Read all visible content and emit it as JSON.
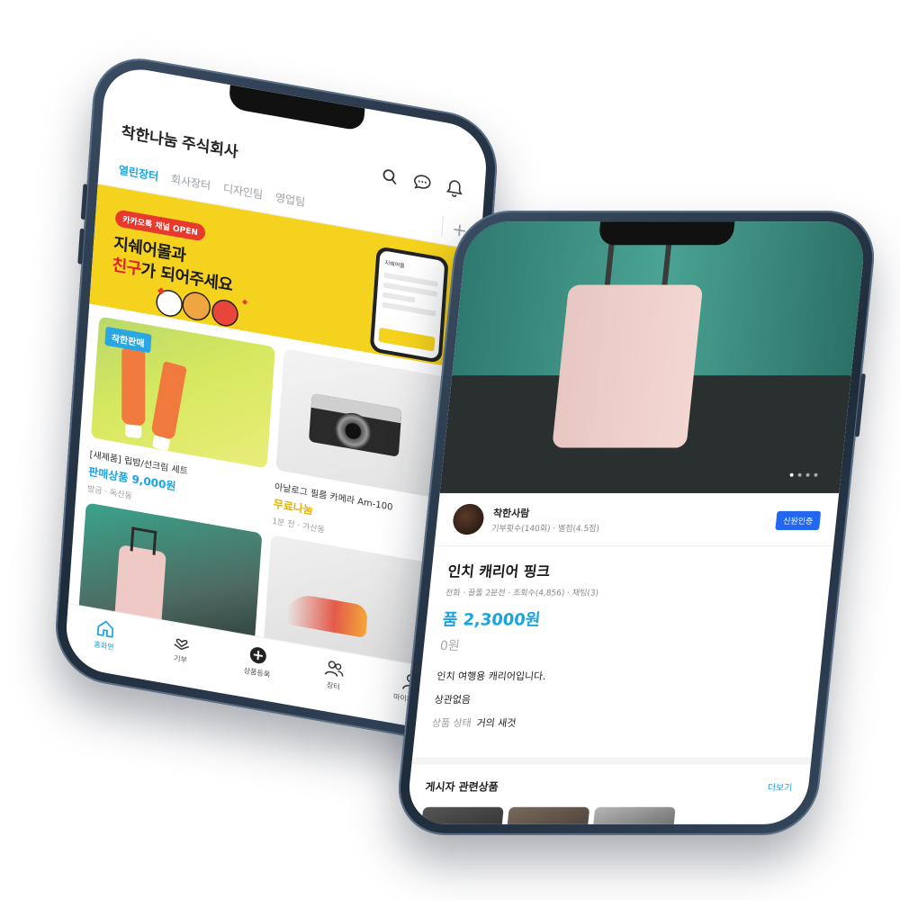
{
  "left_phone": {
    "company_name": "착한나눔 주식회사",
    "header_icons": [
      "search-icon",
      "chat-icon",
      "bell-icon"
    ],
    "tabs": [
      {
        "label": "열린장터",
        "active": true
      },
      {
        "label": "회사장터",
        "active": false
      },
      {
        "label": "디자인팀",
        "active": false
      },
      {
        "label": "영업팀",
        "active": false
      }
    ],
    "tab_add": "+",
    "banner": {
      "badge": "카카오톡 채널 OPEN",
      "line1": "지쉐어몰과",
      "line2_highlight": "친구",
      "line2_rest": "가 되어주세요",
      "mini_title": "지쉐어몰"
    },
    "products": [
      {
        "badge": "착한판매",
        "title": "[새제품] 립밤/선크림 세트",
        "price": "판매상품 9,000원",
        "price_style": "blue",
        "meta": "방금 · 독산동"
      },
      {
        "badge": "",
        "title": "아날로그 필름 카메라 Am-100",
        "price": "무료나눔",
        "price_style": "yellow",
        "meta": "1분 전 · 가산동"
      },
      {
        "badge": "",
        "title": "",
        "price": "",
        "price_style": "blue",
        "meta": ""
      },
      {
        "badge": "",
        "title": "",
        "price": "",
        "price_style": "blue",
        "meta": ""
      }
    ],
    "bottom_nav": [
      {
        "label": "홈화면",
        "icon": "home-icon",
        "active": true
      },
      {
        "label": "기부",
        "icon": "heart-hands-icon",
        "active": false
      },
      {
        "label": "상품등록",
        "icon": "plus-circle-icon",
        "active": false
      },
      {
        "label": "장터",
        "icon": "people-icon",
        "active": false
      },
      {
        "label": "마이페이지",
        "icon": "person-icon",
        "active": false
      }
    ]
  },
  "right_phone": {
    "seller": {
      "name": "착한사람",
      "stats": "기부횟수(140회) · 별점(4.5점)",
      "verify_label": "신원인증"
    },
    "item": {
      "title": "인치 캐리어 핑크",
      "meta": "전화 · 끌올 2분전 · 조회수(4,856) · 채팅(3)",
      "price": "품 2,3000원",
      "orig_price": "0원",
      "description": "인치 여행용 캐리어입니다.",
      "row1_value": "상관없음",
      "row2_key": "상품 상태",
      "row2_value": "거의 새것"
    },
    "related": {
      "title": "게시자 관련상품",
      "more": "더보기"
    },
    "carousel_total": 4,
    "carousel_active": 0
  },
  "colors": {
    "accent_blue": "#1aa3e0",
    "banner_yellow": "#f5d21d",
    "free_yellow": "#e5b400",
    "verify_blue": "#2167f0",
    "highlight_red": "#e3202a"
  }
}
